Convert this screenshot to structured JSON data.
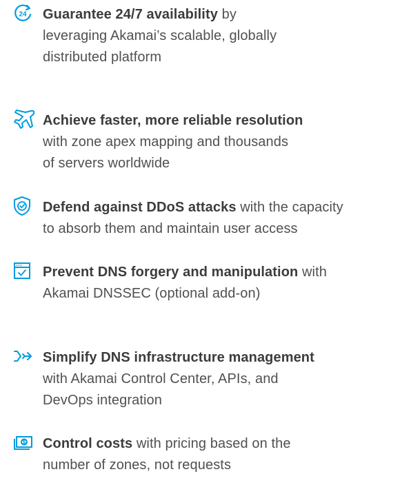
{
  "accent_color": "#009bde",
  "benefits": [
    {
      "icon": "24-hour-refresh-icon",
      "headline": "Guarantee 24/7 availability",
      "lines": [
        " by",
        "leveraging Akamai’s scalable, globally",
        "distributed platform"
      ]
    },
    {
      "icon": "airplane-icon",
      "headline": "Achieve faster, more reliable resolution",
      "lines": [
        "",
        "with zone apex mapping and thousands",
        "of servers worldwide"
      ]
    },
    {
      "icon": "shield-check-icon",
      "headline": "Defend against DDoS attacks",
      "lines": [
        " with the capacity",
        "to absorb them and maintain user access"
      ]
    },
    {
      "icon": "browser-check-icon",
      "headline": "Prevent DNS forgery and manipulation",
      "lines": [
        " with",
        "Akamai DNSSEC (optional add-on)"
      ]
    },
    {
      "icon": "pipeline-arrow-icon",
      "headline": "Simplify DNS infrastructure management",
      "lines": [
        "",
        "with Akamai Control Center, APIs, and",
        "DevOps integration"
      ]
    },
    {
      "icon": "money-bill-icon",
      "headline": "Control costs",
      "lines": [
        " with pricing based on the",
        "number of zones, not requests"
      ]
    }
  ]
}
